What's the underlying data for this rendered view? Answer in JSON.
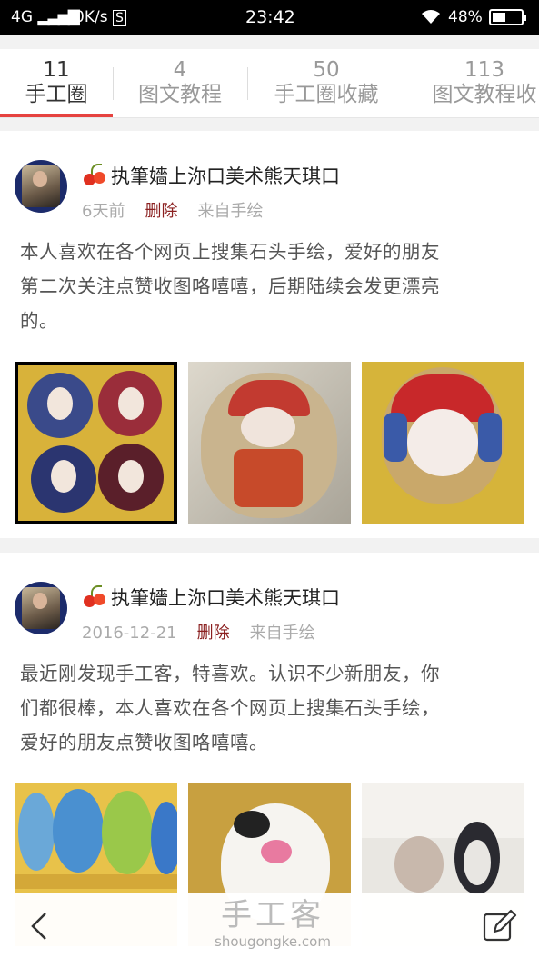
{
  "status_bar": {
    "network": "4G",
    "speed": "0K/s",
    "time": "23:42",
    "battery_percent": "48%",
    "battery_level": 0.48
  },
  "tabs": [
    {
      "count": "11",
      "label": "手工圈",
      "active": true
    },
    {
      "count": "4",
      "label": "图文教程",
      "active": false
    },
    {
      "count": "50",
      "label": "手工圈收藏",
      "active": false
    },
    {
      "count": "113",
      "label": "图文教程收",
      "active": false
    }
  ],
  "posts": [
    {
      "author": "执筆嬙上沵口美术熊天琪口",
      "time": "6天前",
      "delete_label": "删除",
      "source": "来自手绘",
      "text": "本人喜欢在各个网页上搜集石头手绘，爱好的朋友第二次关注点赞收图咯嘻嘻，后期陆续会发更漂亮的。",
      "text_lines": [
        "本人喜欢在各个网页上搜集石头手绘，爱好的朋友",
        "第二次关注点赞收图咯嘻嘻，后期陆续会发更漂亮",
        "的。"
      ],
      "images": [
        "painted-stones-faces-photo",
        "opera-figure-stone-photo",
        "opera-mask-stone-photo"
      ]
    },
    {
      "author": "执筆嬙上沵口美术熊天琪口",
      "time": "2016-12-21",
      "delete_label": "删除",
      "source": "来自手绘",
      "text": "最近刚发现手工客，特喜欢。认识不少新朋友，你们都很棒，本人喜欢在各个网页上搜集石头手绘，爱好的朋友点赞收图咯嘻嘻。",
      "text_lines": [
        "最近刚发现手工客，特喜欢。认识不少新朋友，你",
        "们都很棒，本人喜欢在各个网页上搜集石头手绘，",
        "爱好的朋友点赞收图咯嘻嘻。"
      ],
      "images": [
        "cartoon-stones-photo",
        "cow-stone-photo",
        "owl-penguin-stones-photo"
      ]
    }
  ],
  "bottom_bar": {
    "logo_cn": "手工客",
    "logo_en": "shougongke.com"
  },
  "colors": {
    "accent": "#e64340",
    "delete": "#8b2020",
    "muted": "#aaaaaa"
  }
}
